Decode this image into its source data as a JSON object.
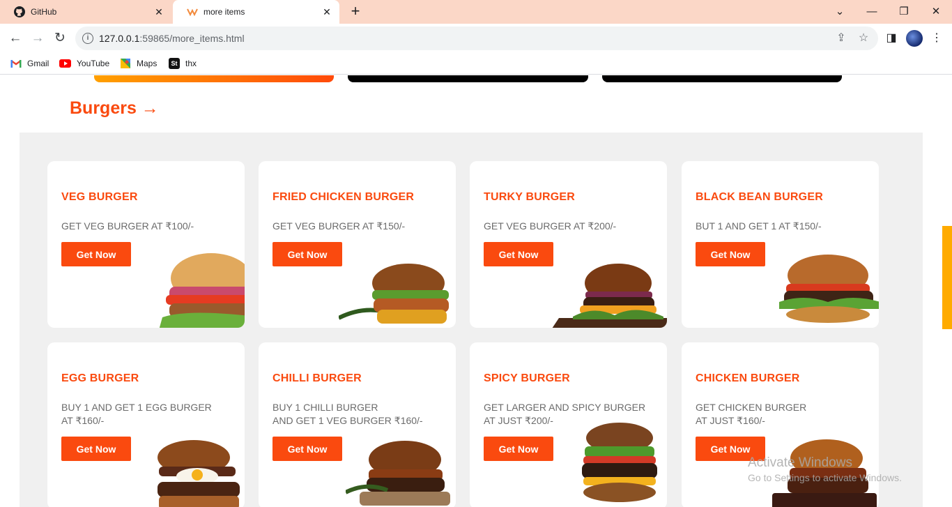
{
  "browser": {
    "tabs": [
      {
        "title": "GitHub",
        "icon": "github-icon"
      },
      {
        "title": "more items",
        "icon": "site-logo-icon"
      }
    ],
    "url": "127.0.0.1:59865/more_items.html",
    "url_host": "127.0.0.1",
    "url_rest": ":59865/more_items.html",
    "bookmarks": [
      {
        "label": "Gmail",
        "icon": "gmail-icon"
      },
      {
        "label": "YouTube",
        "icon": "youtube-icon"
      },
      {
        "label": "Maps",
        "icon": "maps-icon"
      },
      {
        "label": "thx",
        "icon": "st-icon"
      }
    ]
  },
  "section": {
    "title": "Burgers →"
  },
  "cards": [
    {
      "name": "VEG BURGER",
      "desc": "GET VEG BURGER AT ₹100/-",
      "button": "Get Now"
    },
    {
      "name": "FRIED CHICKEN BURGER",
      "desc": "GET VEG BURGER AT ₹150/-",
      "button": "Get Now"
    },
    {
      "name": "TURKY BURGER",
      "desc": "GET VEG BURGER AT ₹200/-",
      "button": "Get Now"
    },
    {
      "name": "BLACK BEAN BURGER",
      "desc": "BUT 1 AND GET 1 AT ₹150/-",
      "button": "Get Now"
    },
    {
      "name": "EGG BURGER",
      "desc": "BUY 1 AND GET 1 EGG BURGER\nAT ₹160/-",
      "button": "Get Now"
    },
    {
      "name": "CHILLI BURGER",
      "desc": "BUY 1 CHILLI BURGER\nAND GET 1 VEG BURGER ₹160/-",
      "button": "Get Now"
    },
    {
      "name": "SPICY BURGER",
      "desc": "GET LARGER AND SPICY BURGER\nAT JUST ₹200/-",
      "button": "Get Now"
    },
    {
      "name": "CHICKEN BURGER",
      "desc": "GET CHICKEN BURGER\nAT JUST ₹160/-",
      "button": "Get Now"
    }
  ],
  "watermark": {
    "line1": "Activate Windows",
    "line2": "Go to Settings to activate Windows."
  },
  "colors": {
    "accent": "#fa4a0f",
    "panel": "#f0f0f0",
    "tabbar": "#fbd7c7"
  }
}
